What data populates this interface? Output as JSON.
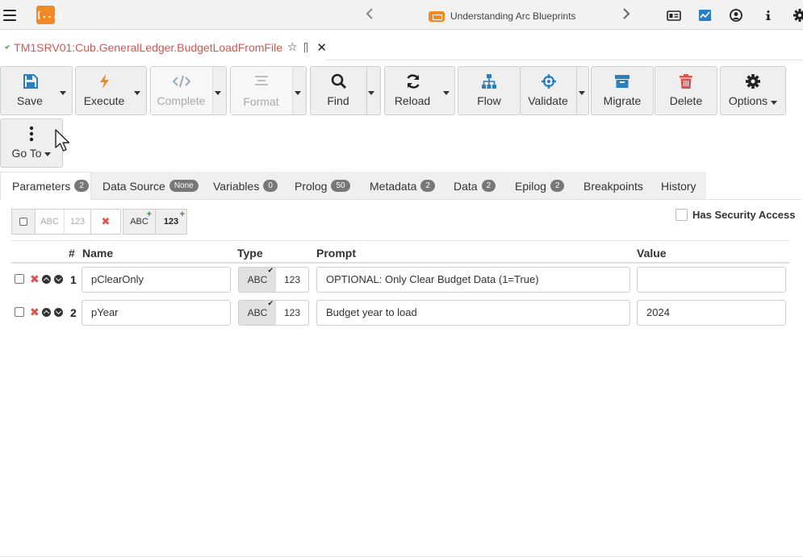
{
  "topbar": {
    "logo_text": "[...]",
    "blueprint_title": "Understanding Arc Blueprints",
    "icons": [
      "menu-icon",
      "arc-logo-icon",
      "chevron-left-icon",
      "blueprint-icon",
      "chevron-right-icon",
      "id-card-icon",
      "activity-icon",
      "user-circle-icon",
      "info-icon",
      "gear-icon"
    ]
  },
  "file_tab": {
    "title": "TM1SRV01:Cub.GeneralLedger.BudgetLoadFromFile",
    "star": "☆",
    "close": "✕"
  },
  "toolbar": {
    "save": "Save",
    "execute": "Execute",
    "complete": "Complete",
    "format": "Format",
    "find": "Find",
    "reload": "Reload",
    "flow": "Flow",
    "validate": "Validate",
    "migrate": "Migrate",
    "delete": "Delete",
    "options": "Options",
    "goto": "Go To"
  },
  "subtabs": [
    {
      "label": "Parameters",
      "badge": "2",
      "active": true
    },
    {
      "label": "Data Source",
      "badge": "None"
    },
    {
      "label": "Variables",
      "badge": "0"
    },
    {
      "label": "Prolog",
      "badge": "50"
    },
    {
      "label": "Metadata",
      "badge": "2"
    },
    {
      "label": "Data",
      "badge": "2"
    },
    {
      "label": "Epilog",
      "badge": "2"
    },
    {
      "label": "Breakpoints",
      "badge": ""
    },
    {
      "label": "History",
      "badge": ""
    }
  ],
  "param_toolbar": {
    "abc": "ABC",
    "n123": "123",
    "delete": "✖",
    "add_abc": "ABC",
    "add_123": "123",
    "plus": "+"
  },
  "has_security_access": "Has Security Access",
  "table": {
    "headers": {
      "num": "#",
      "name": "Name",
      "type": "Type",
      "prompt": "Prompt",
      "value": "Value"
    },
    "rows": [
      {
        "num": "1",
        "name": "pClearOnly",
        "type_abc": "ABC",
        "type_123": "123",
        "prompt": "OPTIONAL: Only Clear Budget Data (1=True)",
        "value": ""
      },
      {
        "num": "2",
        "name": "pYear",
        "type_abc": "ABC",
        "type_123": "123",
        "prompt": "Budget year to load",
        "value": "2024"
      }
    ]
  },
  "colors": {
    "accent_orange": "#f08a24",
    "blue": "#2a7fc1",
    "red": "#d9534f",
    "tab_title_red": "#d9534f"
  }
}
